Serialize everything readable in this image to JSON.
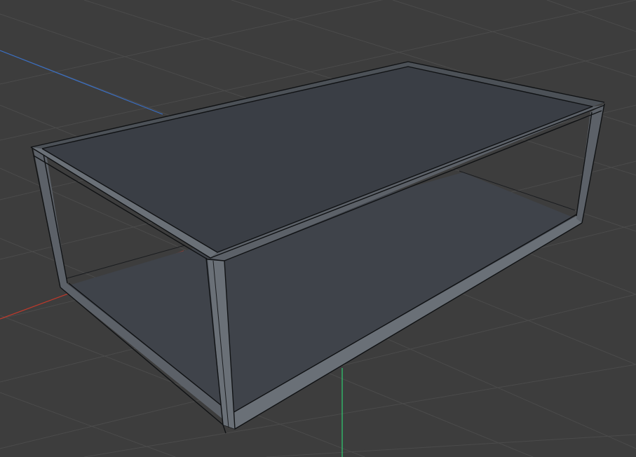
{
  "viewport": {
    "background": "#3d3d3d",
    "grid_color": "#4b4b4b",
    "axis_colors": {
      "x": "#c0392b",
      "y": "#2ecc71",
      "z": "#3a6fc4"
    },
    "object_color": "#3a3e45",
    "frame_color": "#5c6168",
    "edge_color": "#101214"
  }
}
